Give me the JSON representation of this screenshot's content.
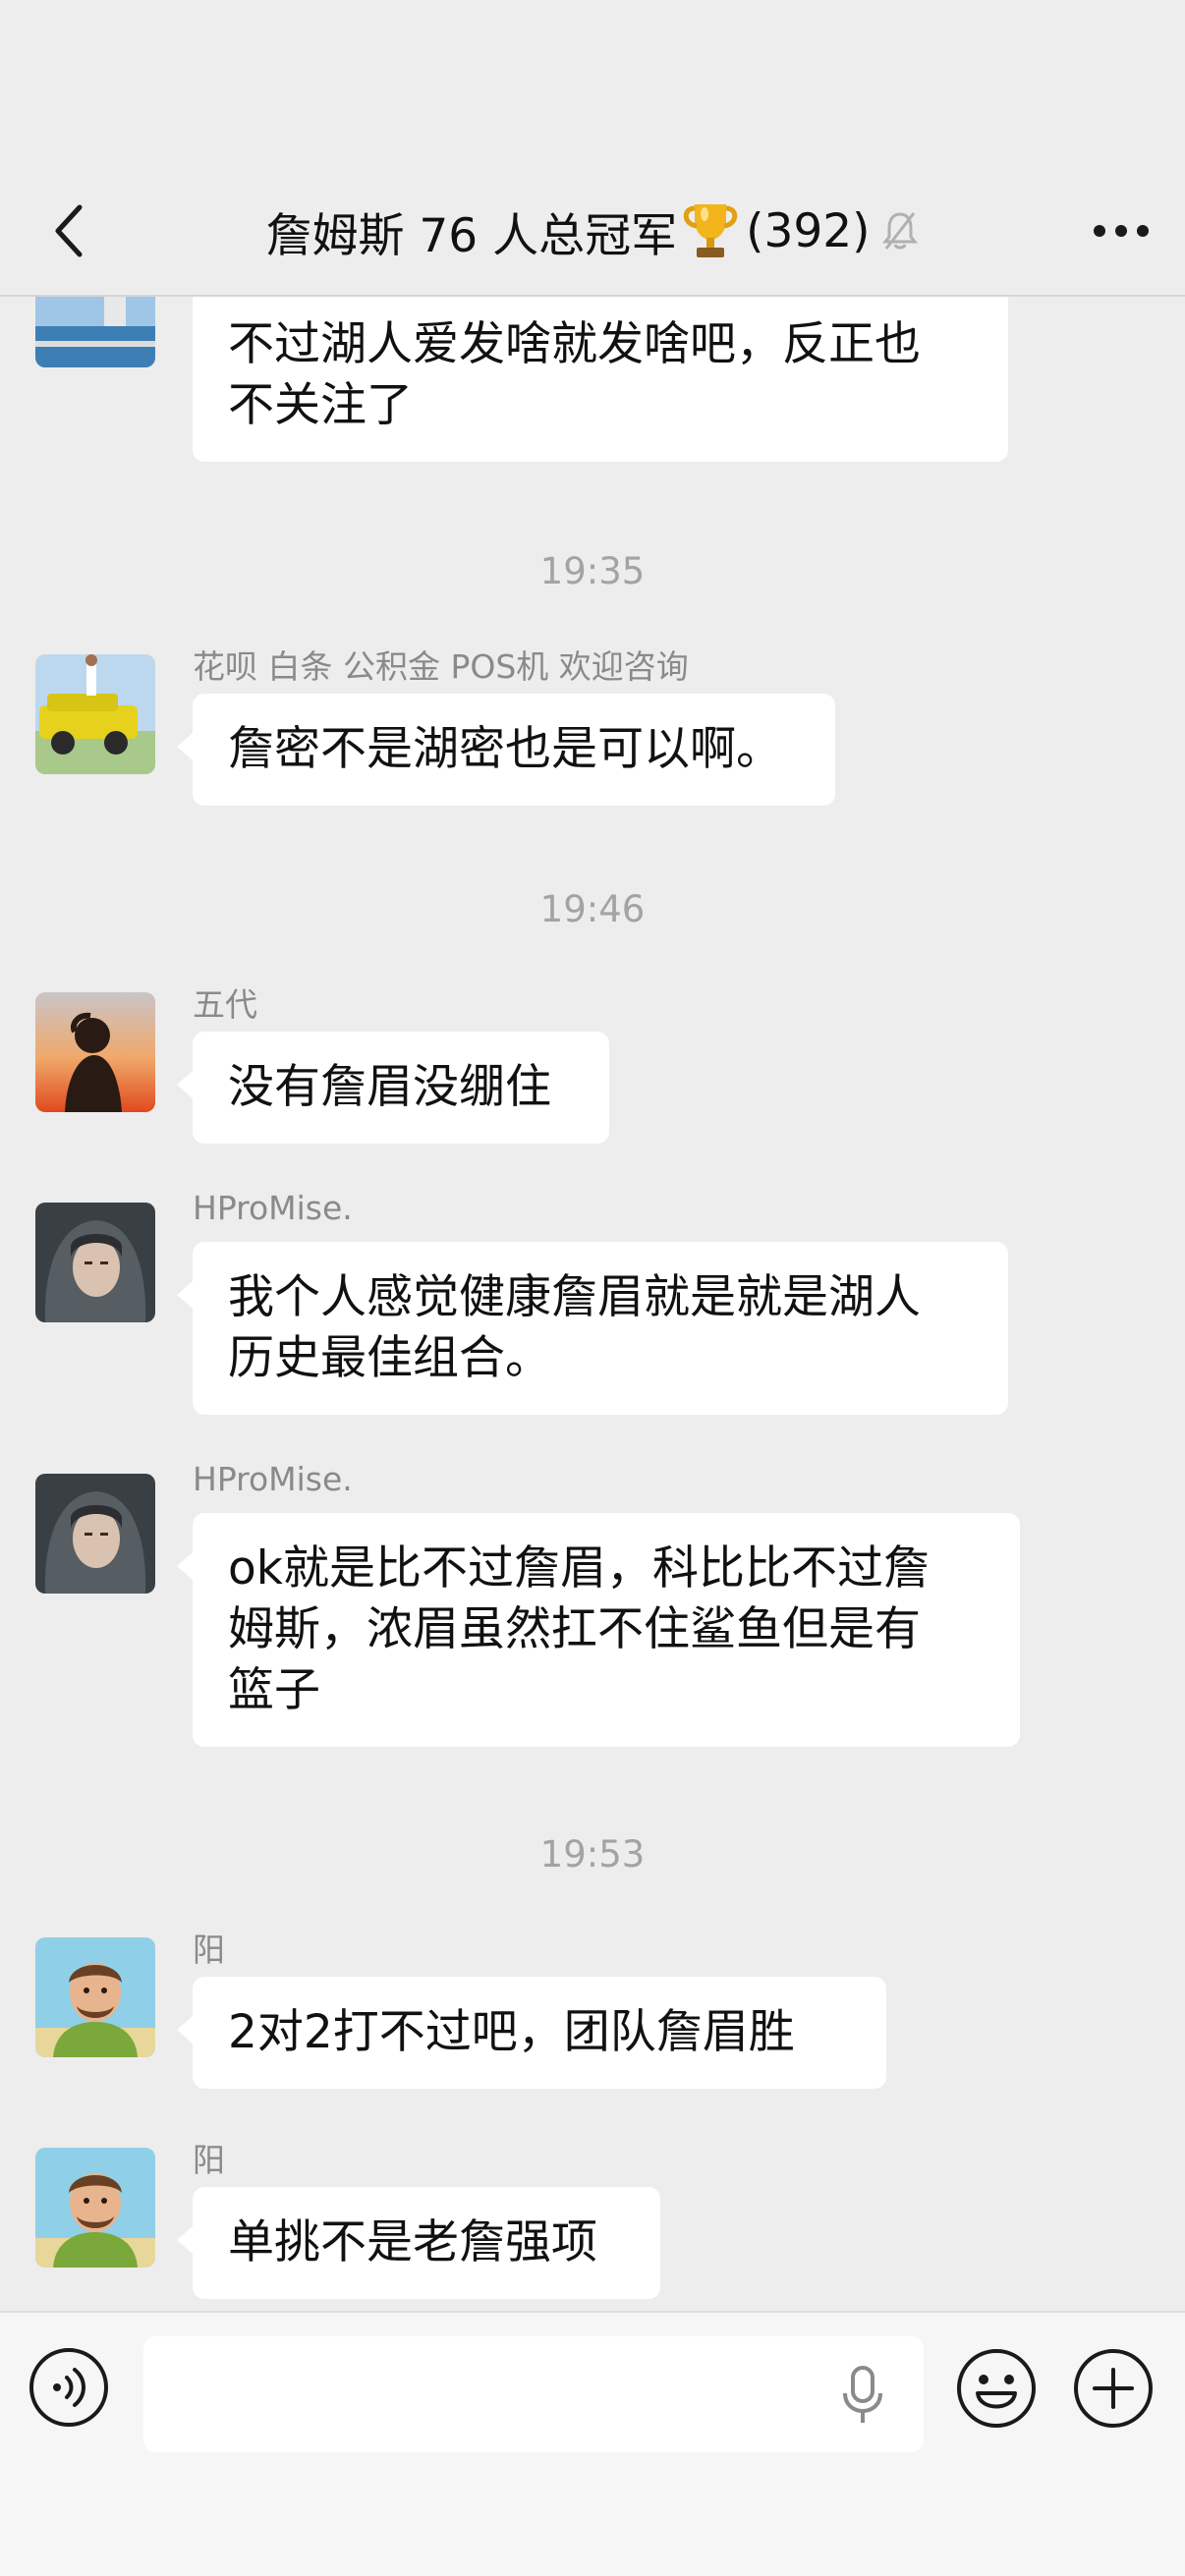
{
  "header": {
    "title": "詹姆斯 76 人总冠军",
    "member_count": "(392)",
    "icons": {
      "back": "chevron-left-icon",
      "trophy": "trophy-icon",
      "muted": "muted-bell-icon",
      "more": "more-dots-icon"
    }
  },
  "messages": [
    {
      "text_lines": [
        "不过湖人爱发啥就发啥吧，反正也",
        "不关注了"
      ]
    },
    {
      "time": "19:35"
    },
    {
      "sender": "花呗 白条 公积金 POS机 欢迎咨询",
      "text": "詹密不是湖密也是可以啊。"
    },
    {
      "time": "19:46"
    },
    {
      "sender": "五代",
      "text": "没有詹眉没绷住"
    },
    {
      "sender": "HProMise.",
      "text_lines": [
        "我个人感觉健康詹眉就是就是湖人",
        "历史最佳组合。"
      ]
    },
    {
      "sender": "HProMise.",
      "text_lines": [
        "ok就是比不过詹眉，科比比不过詹",
        "姆斯，浓眉虽然扛不住鲨鱼但是有",
        "篮子"
      ]
    },
    {
      "time": "19:53"
    },
    {
      "sender": "阳",
      "text": "2对2打不过吧，团队詹眉胜"
    },
    {
      "sender": "阳",
      "text": "单挑不是老詹强项"
    }
  ],
  "input_bar": {
    "value": "",
    "icons": {
      "voice": "voice-mode-icon",
      "mic": "microphone-icon",
      "emoji": "emoji-icon",
      "plus": "plus-icon"
    }
  },
  "colors": {
    "background": "#ededed",
    "bubble": "#ffffff",
    "timestamp": "#a3a3a3",
    "sender": "#8a8a8a",
    "trophy": "#f2b51c"
  }
}
